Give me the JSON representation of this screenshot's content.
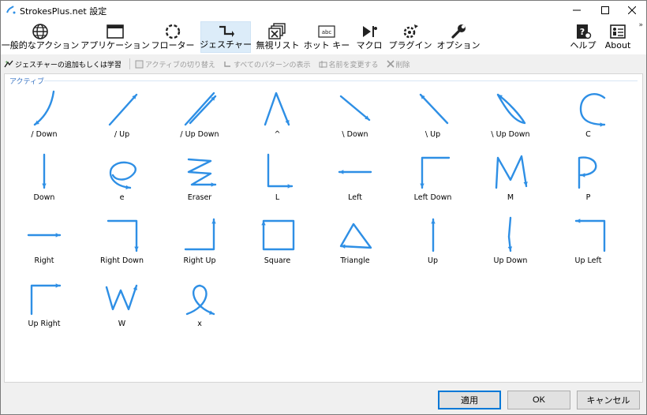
{
  "window": {
    "title": "StrokesPlus.net 設定"
  },
  "ribbon": {
    "items": [
      {
        "label": "一般的なアクション",
        "icon": "globe-icon"
      },
      {
        "label": "アプリケーション",
        "icon": "window-icon"
      },
      {
        "label": "フローター",
        "icon": "floater-icon"
      },
      {
        "label": "ジェスチャー",
        "icon": "gesture-icon"
      },
      {
        "label": "無視リスト",
        "icon": "ignore-list-icon"
      },
      {
        "label": "ホット キー",
        "icon": "keyboard-icon"
      },
      {
        "label": "マクロ",
        "icon": "macro-icon"
      },
      {
        "label": "プラグイン",
        "icon": "plugin-icon"
      },
      {
        "label": "オプション",
        "icon": "wrench-icon"
      },
      {
        "label": "ヘルプ",
        "icon": "help-icon"
      },
      {
        "label": "About",
        "icon": "about-icon"
      }
    ],
    "active_index": 3
  },
  "toolbar": {
    "add_label": "ジェスチャーの追加もしくは学習",
    "toggle_label": "アクティブの切り替え",
    "show_all_label": "すべてのパターンの表示",
    "rename_label": "名前を変更する",
    "delete_label": "削除"
  },
  "group": {
    "label": "アクティブ"
  },
  "gestures": [
    {
      "label": "/ Down"
    },
    {
      "label": "/ Up"
    },
    {
      "label": "/ Up Down"
    },
    {
      "label": "^"
    },
    {
      "label": "\\ Down"
    },
    {
      "label": "\\ Up"
    },
    {
      "label": "\\ Up Down"
    },
    {
      "label": "C"
    },
    {
      "label": "Down"
    },
    {
      "label": "e"
    },
    {
      "label": "Eraser"
    },
    {
      "label": "L"
    },
    {
      "label": "Left"
    },
    {
      "label": "Left Down"
    },
    {
      "label": "M"
    },
    {
      "label": "P"
    },
    {
      "label": "Right"
    },
    {
      "label": "Right Down"
    },
    {
      "label": "Right Up"
    },
    {
      "label": "Square"
    },
    {
      "label": "Triangle"
    },
    {
      "label": "Up"
    },
    {
      "label": "Up Down"
    },
    {
      "label": "Up Left"
    },
    {
      "label": "Up Right"
    },
    {
      "label": "W"
    },
    {
      "label": "x"
    }
  ],
  "stroke_color": "#2e8fe5",
  "footer": {
    "apply_label": "適用",
    "ok_label": "OK",
    "cancel_label": "キャンセル"
  }
}
